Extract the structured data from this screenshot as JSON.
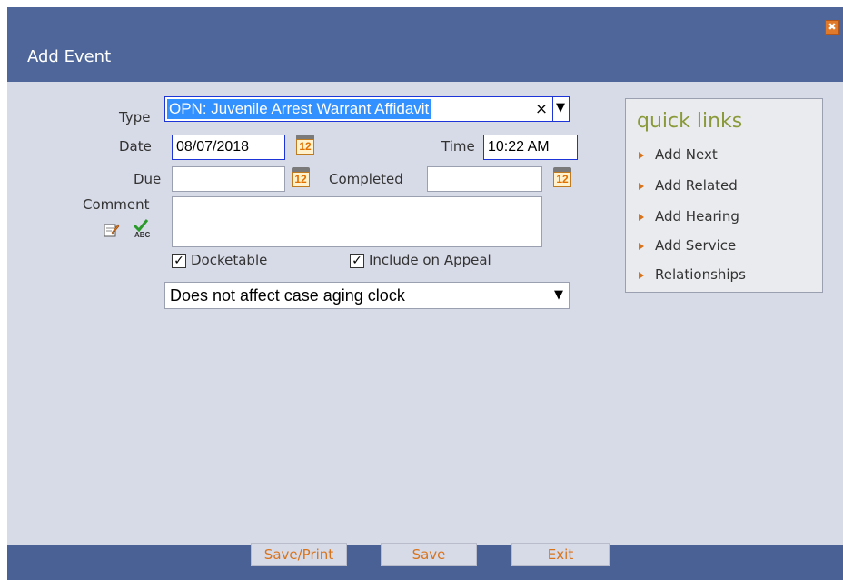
{
  "dialog": {
    "title": "Add Event",
    "close_glyph": "✖"
  },
  "form": {
    "type_label": "Type",
    "type_value": "OPN: Juvenile Arrest Warrant Affidavit",
    "type_clear": "×",
    "dropdown_arrow": "▼",
    "date_label": "Date",
    "date_value": "08/07/2018",
    "time_label": "Time",
    "time_value": "10:22 AM",
    "due_label": "Due",
    "due_value": "",
    "completed_label": "Completed",
    "completed_value": "",
    "comment_label": "Comment",
    "comment_value": "",
    "calendar_day": "12",
    "spellcheck_text": "ABC",
    "docketable_label": "Docketable",
    "docketable_checked": true,
    "appeal_label": "Include on Appeal",
    "appeal_checked": true,
    "check_glyph": "✓",
    "aging_value": "Does not affect case aging clock"
  },
  "quick_links": {
    "title": "quick links",
    "items": [
      "Add Next",
      "Add Related",
      "Add Hearing",
      "Add Service",
      "Relationships"
    ]
  },
  "footer": {
    "save_print": "Save/Print",
    "save": "Save",
    "exit": "Exit"
  },
  "icons": [
    "close-icon",
    "calendar-icon",
    "edit-comment-icon",
    "spellcheck-icon",
    "dropdown-arrow-icon",
    "clear-icon",
    "arrow-bullet-icon"
  ]
}
